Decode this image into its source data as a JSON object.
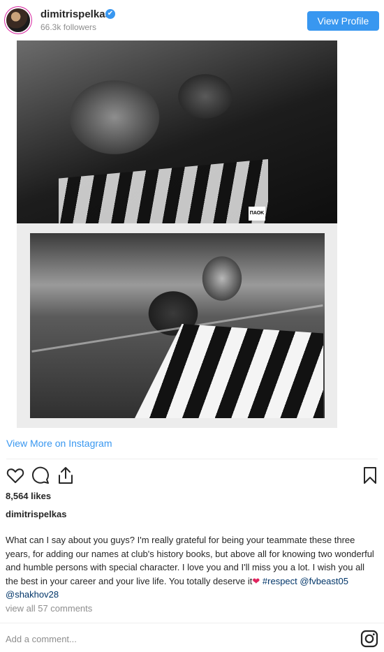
{
  "header": {
    "username": "dimitrispelkas",
    "followers": "66.3k followers",
    "view_profile_label": "View Profile",
    "verified_icon": "✔"
  },
  "photo": {
    "badge_text": "ΠΑΟΚ"
  },
  "links": {
    "view_more": "View More on Instagram"
  },
  "post": {
    "likes": "8,564 likes",
    "caption_user": "dimitrispelkas",
    "caption_text": "What can I say about you guys? I'm really grateful for being your teammate these three years, for adding our names at club's history books, but above all for knowing two wonderful and humble persons with special character. I love you and I'll miss you a lot. I wish you all the best in your career and your live life. You totally deserve it",
    "heart_emoji": "❤",
    "hashtag": "#respect",
    "mention1": "@fvbeast05",
    "mention2": "@shakhov28",
    "view_comments": "view all 57 comments",
    "add_comment_placeholder": "Add a comment..."
  },
  "colors": {
    "accent": "#3897f0",
    "link": "#003569",
    "muted": "#8e8e8e"
  },
  "icons": [
    "heart-icon",
    "comment-icon",
    "share-icon",
    "bookmark-icon",
    "instagram-logo-icon"
  ]
}
